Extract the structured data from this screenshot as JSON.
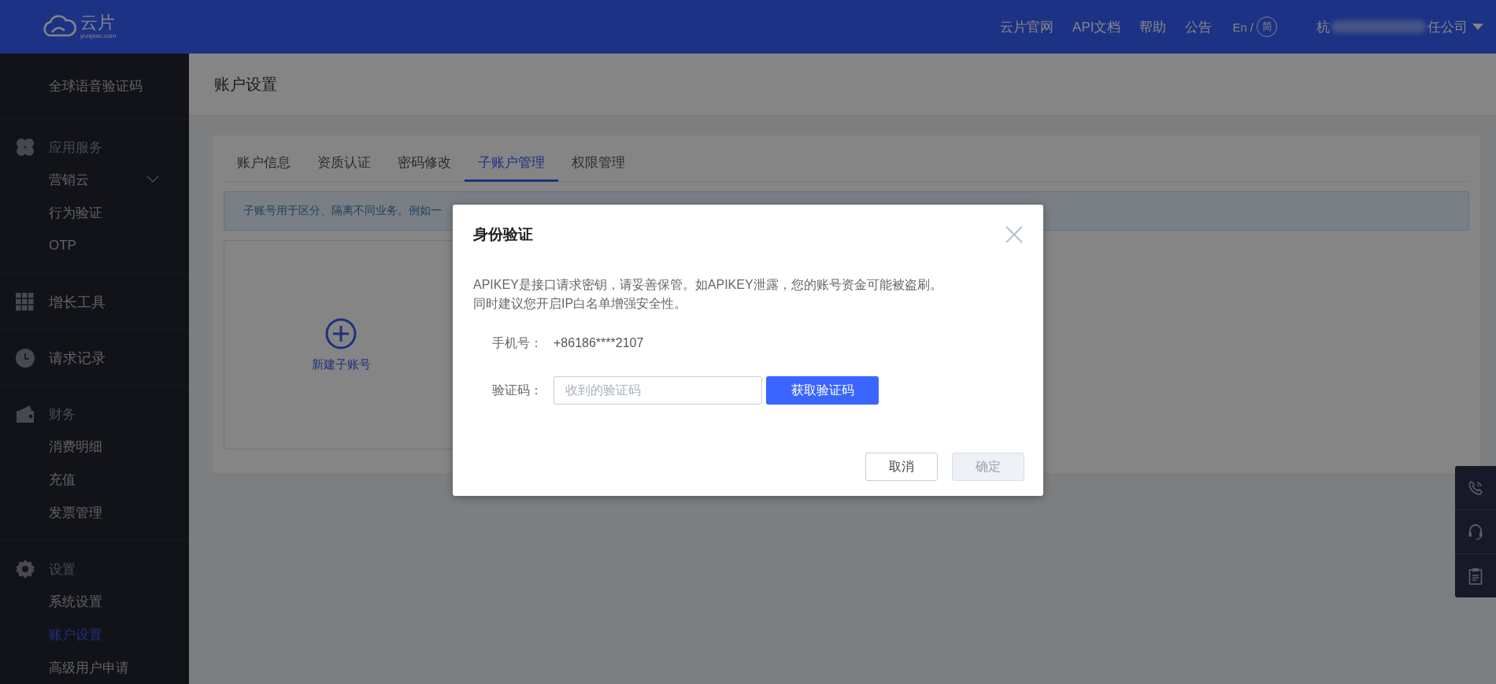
{
  "header": {
    "logo": {
      "name": "云片",
      "domain": "yunpian.com"
    },
    "nav": [
      "云片官网",
      "API文档",
      "帮助",
      "公告"
    ],
    "language": {
      "en": "En",
      "separator": "/",
      "zh": "简"
    },
    "account": {
      "start": "杭",
      "end": "任公司"
    }
  },
  "sidebar": {
    "sections": [
      {
        "kind": "group",
        "items": [
          {
            "label": "全球语音验证码",
            "selected": false
          }
        ]
      },
      {
        "kind": "group",
        "title": "应用服务",
        "items": [
          {
            "label": "营销云",
            "selected": false,
            "expanded": false
          },
          {
            "label": "行为验证",
            "selected": false
          },
          {
            "label": "OTP",
            "selected": false
          }
        ]
      },
      {
        "kind": "link",
        "title": "增长工具"
      },
      {
        "kind": "link",
        "title": "请求记录"
      },
      {
        "kind": "group",
        "title": "财务",
        "items": [
          {
            "label": "消费明细",
            "selected": false
          },
          {
            "label": "充值",
            "selected": false
          },
          {
            "label": "发票管理",
            "selected": false
          }
        ]
      },
      {
        "kind": "group",
        "title": "设置",
        "items": [
          {
            "label": "系统设置",
            "selected": false
          },
          {
            "label": "账户设置",
            "selected": true
          },
          {
            "label": "高级用户申请",
            "selected": false
          }
        ]
      }
    ]
  },
  "page_title": "账户设置",
  "tabs": [
    {
      "label": "账户信息",
      "selected": false
    },
    {
      "label": "资质认证",
      "selected": false
    },
    {
      "label": "密码修改",
      "selected": false
    },
    {
      "label": "子账户管理",
      "selected": true
    },
    {
      "label": "权限管理",
      "selected": false
    }
  ],
  "notice": "子账号用于区分、隔离不同业务。例如一",
  "new_card": {
    "label": "新建子账号"
  },
  "dialog": {
    "title": "身份验证",
    "message": [
      "APIKEY是接口请求密钥，请妥善保管。如APIKEY泄露，您的账号资金可能被盗刷。",
      "同时建议您开启IP白名单增强安全性。"
    ],
    "fields": [
      {
        "kind": "text",
        "label": "手机号：",
        "value": "+86186****2107"
      },
      {
        "kind": "input",
        "label": "验证码：",
        "placeholder": "收到的验证码",
        "button": "获取验证码"
      }
    ],
    "buttons": [
      {
        "label": "取消",
        "kind": "default",
        "disabled": false
      },
      {
        "label": "确定",
        "kind": "primary",
        "disabled": true
      }
    ]
  }
}
